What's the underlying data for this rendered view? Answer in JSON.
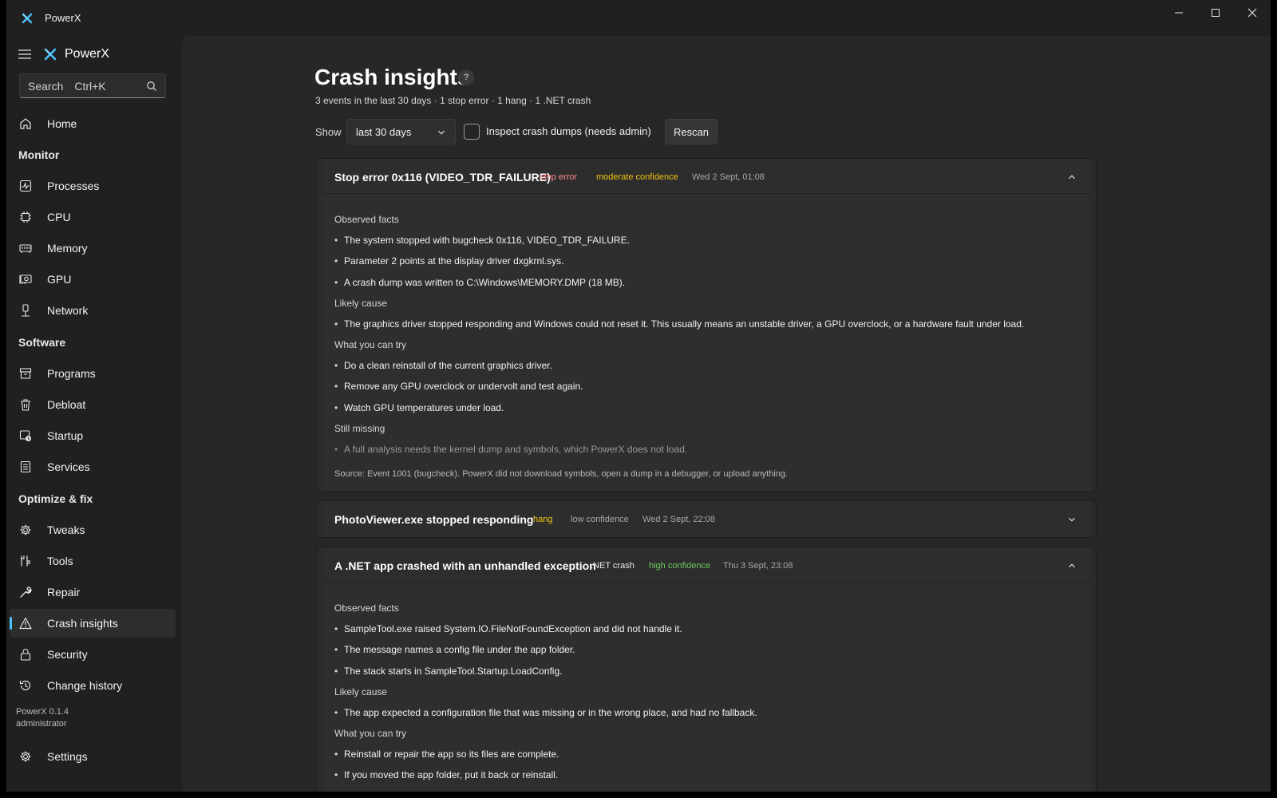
{
  "window": {
    "title": "PowerX"
  },
  "sidebar": {
    "app_name": "PowerX",
    "search_placeholder": "Search",
    "search_shortcut": "Ctrl+K",
    "home": "Home",
    "group_monitor": "Monitor",
    "group_software": "Software",
    "group_optimize": "Optimize & fix",
    "items": {
      "processes": "Processes",
      "cpu": "CPU",
      "memory": "Memory",
      "gpu": "GPU",
      "network": "Network",
      "programs": "Programs",
      "debloat": "Debloat",
      "startup": "Startup",
      "services": "Services",
      "tweaks": "Tweaks",
      "tools": "Tools",
      "repair": "Repair",
      "crash_insights": "Crash insights",
      "security": "Security",
      "change_history": "Change history",
      "settings": "Settings"
    },
    "active": "Crash insights",
    "version": "PowerX 0.1.4",
    "user": "administrator",
    "accent": "#4cc2ff"
  },
  "page": {
    "title": "Crash insights",
    "help": "?",
    "summary": "3 events in the last 30 days · 1 stop error · 1 hang · 1 .NET crash",
    "show_label": "Show",
    "range_value": "last 30 days",
    "inspect_label": "Inspect crash dumps (needs admin)",
    "inspect_checked": false,
    "rescan": "Rescan"
  },
  "events": [
    {
      "title": "Stop error 0x116 (VIDEO_TDR_FAILURE)",
      "kind": "stop error",
      "kind_color": "#ff8a8a",
      "confidence": "moderate confidence",
      "confidence_color": "#f2c40f",
      "time": "Wed 2 Sept, 01:08",
      "expanded": true,
      "sections": {
        "facts_h": "Observed facts",
        "facts": [
          "The system stopped with bugcheck 0x116, VIDEO_TDR_FAILURE.",
          "Parameter 2 points at the display driver dxgkrnl.sys.",
          "A crash dump was written to C:\\Windows\\MEMORY.DMP (18 MB)."
        ],
        "cause_h": "Likely cause",
        "cause": [
          "The graphics driver stopped responding and Windows could not reset it. This usually means an unstable driver, a GPU overclock, or a hardware fault under load."
        ],
        "try_h": "What you can try",
        "try": [
          "Do a clean reinstall of the current graphics driver.",
          "Remove any GPU overclock or undervolt and test again.",
          "Watch GPU temperatures under load."
        ],
        "missing_h": "Still missing",
        "missing": [
          "A full analysis needs the kernel dump and symbols, which PowerX does not load."
        ],
        "source": "Source: Event 1001 (bugcheck). PowerX did not download symbols, open a dump in a debugger, or upload anything."
      }
    },
    {
      "title": "PhotoViewer.exe stopped responding",
      "kind": "hang",
      "kind_color": "#f2c40f",
      "confidence": "low confidence",
      "confidence_color": "#a8a8a8",
      "time": "Wed 2 Sept, 22:08",
      "expanded": false
    },
    {
      "title": "A .NET app crashed with an unhandled exception",
      "kind": ".NET crash",
      "kind_color": "#e8e8e8",
      "confidence": "high confidence",
      "confidence_color": "#6ccb5f",
      "time": "Thu 3 Sept, 23:08",
      "expanded": true,
      "sections": {
        "facts_h": "Observed facts",
        "facts": [
          "SampleTool.exe raised System.IO.FileNotFoundException and did not handle it.",
          "The message names a config file under the app folder.",
          "The stack starts in SampleTool.Startup.LoadConfig."
        ],
        "cause_h": "Likely cause",
        "cause": [
          "The app expected a configuration file that was missing or in the wrong place, and had no fallback."
        ],
        "try_h": "What you can try",
        "try": [
          "Reinstall or repair the app so its files are complete.",
          "If you moved the app folder, put it back or reinstall."
        ]
      }
    }
  ]
}
